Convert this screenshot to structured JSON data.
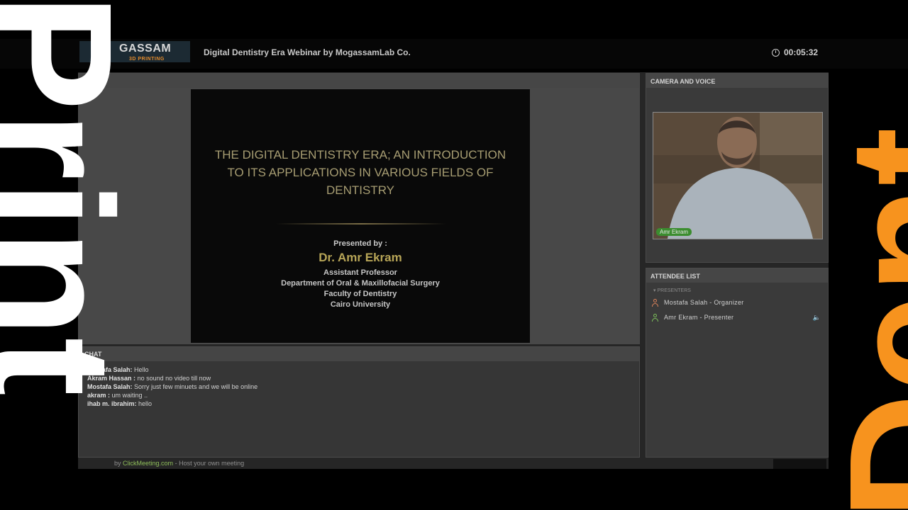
{
  "overlay": {
    "left_text": "Print",
    "right_text": "Dent"
  },
  "header": {
    "logo_text": "GASSAM",
    "logo_subtext": "3D PRINTING",
    "title": "Digital Dentistry Era Webinar by MogassamLab Co.",
    "timer": "00:05:32"
  },
  "slide": {
    "title": "THE DIGITAL DENTISTRY ERA; AN INTRODUCTION TO ITS APPLICATIONS IN VARIOUS FIELDS OF DENTISTRY",
    "presented_by": "Presented by :",
    "presenter_name": "Dr. Amr Ekram",
    "presenter_lines": [
      "Assistant Professor",
      "Department of Oral & Maxillofacial Surgery",
      "Faculty of Dentistry",
      "Cairo University"
    ]
  },
  "chat": {
    "title": "CHAT",
    "messages": [
      {
        "author": "Mostafa Salah:",
        "text": "Hello"
      },
      {
        "author": "Akram Hassan :",
        "text": "no sound no video till now"
      },
      {
        "author": "Mostafa Salah:",
        "text": "Sorry  just few minuets and we will be online"
      },
      {
        "author": "akram :",
        "text": "um waiting .."
      },
      {
        "author": "ihab m. ibrahim:",
        "text": "hello"
      }
    ]
  },
  "footer": {
    "prefix": "by",
    "link": "ClickMeeting.com",
    "suffix": "- Host your own meeting"
  },
  "camera": {
    "title": "CAMERA AND VOICE",
    "video_label": "Amr Ekram"
  },
  "attendees": {
    "title": "ATTENDEE LIST",
    "group_label": "PRESENTERS",
    "items": [
      {
        "name": "Mostafa Salah - Organizer",
        "icon": "person-icon",
        "color": "#d9825b"
      },
      {
        "name": "Amr Ekram - Presenter",
        "icon": "person-icon",
        "color": "#7cbf5a"
      }
    ]
  },
  "colors": {
    "accent_orange": "#f7931e",
    "presenter_gold": "#b7a557",
    "link_green": "#8fbf5a"
  }
}
